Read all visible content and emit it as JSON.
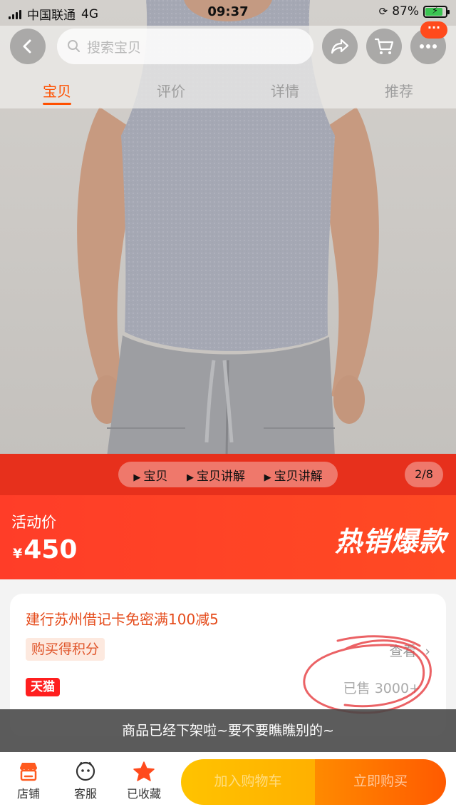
{
  "status_bar": {
    "carrier": "中国联通",
    "network": "4G",
    "time": "09:37",
    "battery": "87%"
  },
  "header": {
    "search_placeholder": "搜索宝贝",
    "more_badge": "···",
    "tabs": [
      {
        "label": "宝贝",
        "active": true
      },
      {
        "label": "评价",
        "active": false
      },
      {
        "label": "详情",
        "active": false
      },
      {
        "label": "推荐",
        "active": false
      }
    ]
  },
  "media_strip": {
    "items": [
      "宝贝",
      "宝贝讲解",
      "宝贝讲解"
    ],
    "counter": "2/8"
  },
  "price_banner": {
    "label": "活动价",
    "currency": "¥",
    "price": "450",
    "tag": "热销爆款"
  },
  "info_card": {
    "promo": "建行苏州借记卡免密满100减5",
    "points": "购买得积分",
    "view_link": "查看",
    "tmall_badge": "天猫",
    "sold": "已售 3000+"
  },
  "toast": "商品已经下架啦~要不要瞧瞧别的~",
  "bottom_bar": {
    "store": "店铺",
    "service": "客服",
    "favorited": "已收藏",
    "add_to_cart": "加入购物车",
    "buy_now": "立即购买"
  },
  "colors": {
    "accent": "#ff5000",
    "banner_red": "#ff3d28",
    "strip_red": "#e7301c",
    "cart_yellow": "#ffc300",
    "buy_orange": "#ff6a00"
  },
  "icons": [
    "back-icon",
    "search-icon",
    "share-icon",
    "cart-icon",
    "more-icon",
    "store-icon",
    "service-icon",
    "star-icon",
    "play-icon",
    "chevron-right-icon"
  ]
}
